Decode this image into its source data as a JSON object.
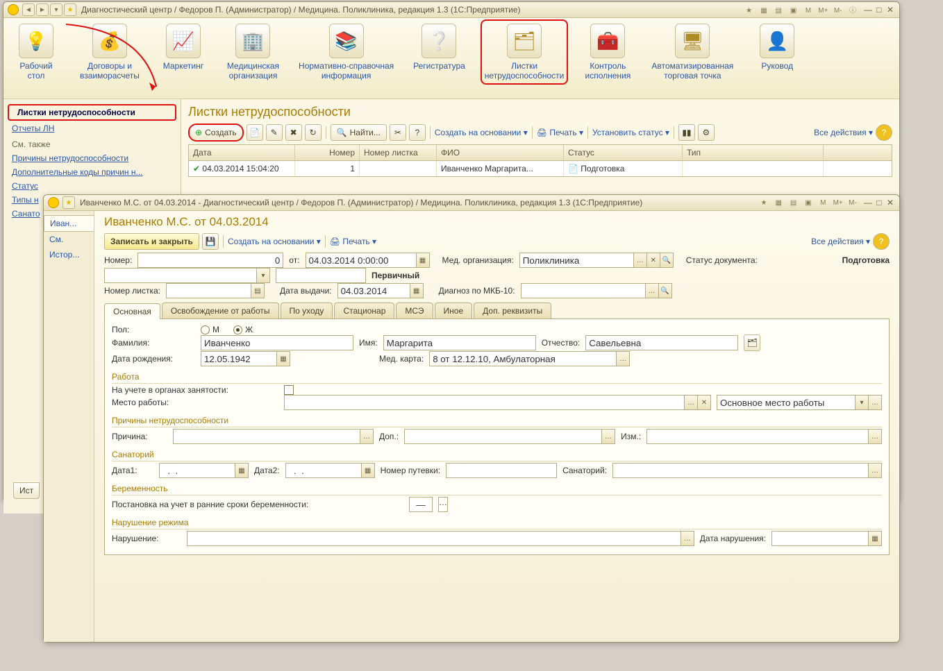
{
  "main_window": {
    "title": "Диагностический центр / Федоров П. (Администратор) / Медицина. Поликлиника, редакция 1.3  (1С:Предприятие)",
    "toolbar": [
      {
        "icon": "🛋",
        "label": "Рабочий\nстол"
      },
      {
        "icon": "💰",
        "label": "Договоры и\nвзаиморасчеты"
      },
      {
        "icon": "📊",
        "label": "Маркетинг"
      },
      {
        "icon": "🏥",
        "label": "Медицинская\nорганизация"
      },
      {
        "icon": "📚",
        "label": "Нормативно-справочная\nинформация"
      },
      {
        "icon": "❓",
        "label": "Регистратура"
      },
      {
        "icon": "📄",
        "label": "Листки\nнетрудоспособности",
        "hl": true
      },
      {
        "icon": "🧰",
        "label": "Контроль\nисполнения"
      },
      {
        "icon": "🖥",
        "label": "Автоматизированная\nторговая точка"
      },
      {
        "icon": "👤",
        "label": "Руковод"
      }
    ],
    "side": {
      "links1": [
        "Листки нетрудоспособности",
        "Отчеты ЛН"
      ],
      "group": "См. также",
      "links2": [
        "Причины нетрудоспособности",
        "Дополнительные коды причин н...",
        "Статус",
        "Типы н",
        "Санато"
      ]
    },
    "list": {
      "heading": "Листки нетрудоспособности",
      "cmd": {
        "create": "Создать",
        "find": "Найти...",
        "create_based": "Создать на основании",
        "print": "Печать",
        "set_status": "Установить статус",
        "all_actions": "Все действия"
      },
      "cols": [
        "Дата",
        "Номер",
        "Номер листка",
        "ФИО",
        "Статус",
        "Тип"
      ],
      "row": {
        "date": "04.03.2014 15:04:20",
        "num": "1",
        "listnum": "",
        "fio": "Иванченко Маргарита...",
        "status": "Подготовка",
        "type": ""
      }
    },
    "bottom_tab": "Ист"
  },
  "child_window": {
    "title": "Иванченко М.С. от 04.03.2014 - Диагностический центр / Федоров П. (Администратор) / Медицина. Поликлиника, редакция 1.3  (1С:Предприятие)",
    "left_tabs": [
      "Иван...",
      "См.",
      "Истор..."
    ],
    "heading": "Иванченко М.С. от 04.03.2014",
    "cmd": {
      "save_close": "Записать и закрыть",
      "create_based": "Создать на основании",
      "print": "Печать",
      "all_actions": "Все действия"
    },
    "header_fields": {
      "number_lbl": "Номер:",
      "number": "0",
      "from_lbl": "от:",
      "from": "04.03.2014 0:00:00",
      "org_lbl": "Мед. организация:",
      "org": "Поликлиника",
      "status_lbl": "Статус документа:",
      "status": "Подготовка",
      "primary": "Первичный",
      "listnum_lbl": "Номер листка:",
      "issue_lbl": "Дата выдачи:",
      "issue": "04.03.2014",
      "diag_lbl": "Диагноз по МКБ-10:"
    },
    "tabs": [
      "Основная",
      "Освобождение от работы",
      "По уходу",
      "Стационар",
      "МСЭ",
      "Иное",
      "Доп. реквизиты"
    ],
    "main_tab": {
      "sex_lbl": "Пол:",
      "sex_m": "М",
      "sex_f": "Ж",
      "lastname_lbl": "Фамилия:",
      "lastname": "Иванченко",
      "firstname_lbl": "Имя:",
      "firstname": "Маргарита",
      "midname_lbl": "Отчество:",
      "midname": "Савельевна",
      "dob_lbl": "Дата рождения:",
      "dob": "12.05.1942",
      "card_lbl": "Мед. карта:",
      "card": "8 от 12.12.10, Амбулаторная",
      "sec_work": "Работа",
      "emp_reg_lbl": "На учете в органах занятости:",
      "workplace_lbl": "Место работы:",
      "work_type": "Основное место работы",
      "sec_reason": "Причины нетрудоспособности",
      "reason_lbl": "Причина:",
      "addl_lbl": "Доп.:",
      "chg_lbl": "Изм.:",
      "sec_san": "Санаторий",
      "d1_lbl": "Дата1:",
      "d2_lbl": "Дата2:",
      "d_placeholder": "  .  .    ",
      "voucher_lbl": "Номер путевки:",
      "san_lbl": "Санаторий:",
      "sec_preg": "Беременность",
      "preg_lbl": "Постановка на учет в ранние сроки беременности:",
      "preg_val": "—",
      "sec_viol": "Нарушение режима",
      "viol_lbl": "Нарушение:",
      "viol_date_lbl": "Дата нарушения:"
    }
  }
}
